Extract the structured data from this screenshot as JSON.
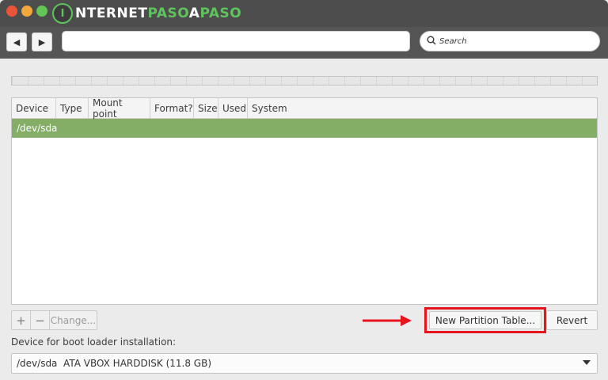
{
  "window": {
    "logo_mark": "I",
    "logo_main": "NTERNET",
    "logo_accent1": "PASO",
    "logo_accent2": "A",
    "logo_tail": "PASO"
  },
  "toolbar": {
    "back_icon": "◀",
    "forward_icon": "▶",
    "search_placeholder": "Search"
  },
  "table": {
    "columns": [
      "Device",
      "Type",
      "Mount point",
      "Format?",
      "Size",
      "Used",
      "System"
    ],
    "rows": [
      {
        "device": "/dev/sda",
        "selected": true
      }
    ]
  },
  "controls": {
    "add_label": "+",
    "remove_label": "−",
    "change_label": "Change...",
    "new_partition_table_label": "New Partition Table...",
    "revert_label": "Revert"
  },
  "bootloader": {
    "label": "Device for boot loader installation:",
    "selected_value": "/dev/sda  ATA VBOX HARDDISK (11.8 GB)"
  },
  "colors": {
    "selection": "#84ad66",
    "highlight": "#e8141d",
    "brand_green": "#5fc45e"
  }
}
